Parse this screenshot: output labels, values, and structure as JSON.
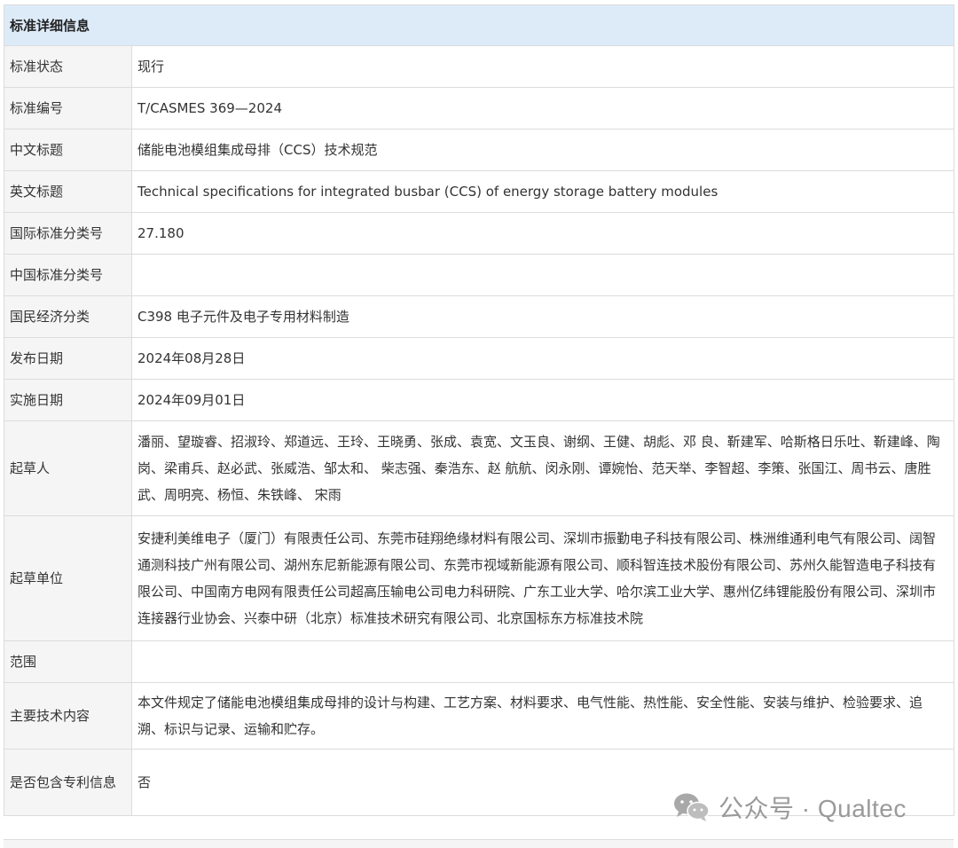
{
  "table": {
    "header": "标准详细信息",
    "rows": [
      {
        "label": "标准状态",
        "value": "现行"
      },
      {
        "label": "标准编号",
        "value": "T/CASMES 369—2024"
      },
      {
        "label": "中文标题",
        "value": "储能电池模组集成母排（CCS）技术规范"
      },
      {
        "label": "英文标题",
        "value": "Technical specifications for integrated busbar (CCS) of energy storage battery modules"
      },
      {
        "label": "国际标准分类号",
        "value": "27.180"
      },
      {
        "label": "中国标准分类号",
        "value": ""
      },
      {
        "label": "国民经济分类",
        "value": "C398 电子元件及电子专用材料制造"
      },
      {
        "label": "发布日期",
        "value": "2024年08月28日"
      },
      {
        "label": "实施日期",
        "value": "2024年09月01日"
      },
      {
        "label": "起草人",
        "value": "潘丽、望璇睿、招淑玲、郑道远、王玲、王晓勇、张成、袁宽、文玉良、谢纲、王健、胡彪、邓 良、靳建军、哈斯格日乐吐、靳建峰、陶岗、梁甫兵、赵必武、张威浩、邹太和、 柴志强、秦浩东、赵 航航、闵永刚、谭婉怡、范天举、李智超、李策、张国江、周书云、唐胜武、周明亮、杨恒、朱铁峰、 宋雨"
      },
      {
        "label": "起草单位",
        "value": "安捷利美维电子（厦门）有限责任公司、东莞市硅翔绝缘材料有限公司、深圳市振勤电子科技有限公司、株洲维通利电气有限公司、阔智通测科技广州有限公司、湖州东尼新能源有限公司、东莞市视域新能源有限公司、顺科智连技术股份有限公司、苏州久能智造电子科技有限公司、中国南方电网有限责任公司超高压输电公司电力科研院、广东工业大学、哈尔滨工业大学、惠州亿纬锂能股份有限公司、深圳市连接器行业协会、兴泰中研（北京）标准技术研究有限公司、北京国标东方标准技术院"
      },
      {
        "label": "范围",
        "value": ""
      },
      {
        "label": "主要技术内容",
        "value": "本文件规定了储能电池模组集成母排的设计与构建、工艺方案、材料要求、电气性能、热性能、安全性能、安装与维护、检验要求、追溯、标识与记录、运输和贮存。"
      },
      {
        "label": "是否包含专利信息",
        "value": "否"
      }
    ]
  },
  "watermark": {
    "icon": "wechat-icon",
    "text": "公众号 · Qualtec"
  },
  "colors": {
    "header_bg": "#ddebf9",
    "label_bg": "#f5f5f5",
    "border": "#dcdcdc",
    "watermark": "#9a9a9a"
  }
}
